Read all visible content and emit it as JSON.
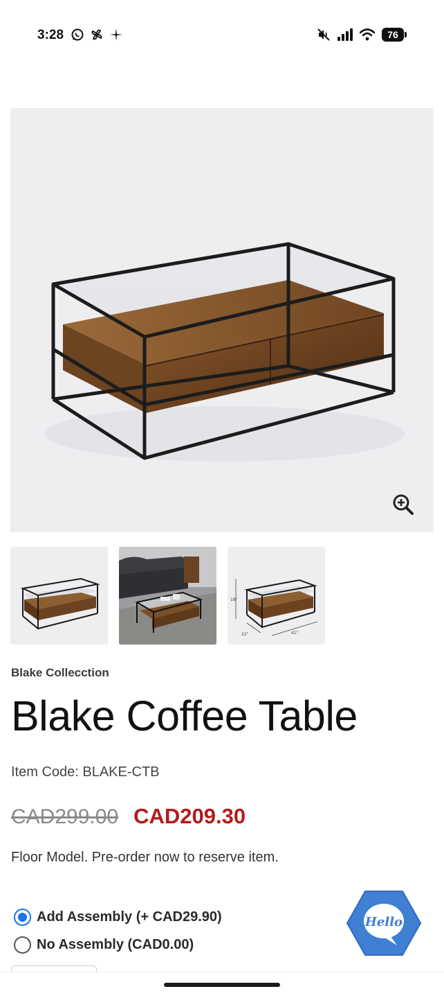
{
  "status_bar": {
    "time": "3:28",
    "battery": "76",
    "icons": [
      "whatsapp-icon",
      "pinwheel-icon",
      "sparkle-icon",
      "mute-icon",
      "signal-icon",
      "wifi-icon",
      "battery-icon"
    ]
  },
  "gallery": {
    "main_image": "glass-top coffee table with rustic wood drawers",
    "zoom_icon": "zoom-in-icon",
    "thumbnails": [
      "table-front-view",
      "table-room-view",
      "table-dimensions-view"
    ]
  },
  "thumb_dims": {
    "height": "18\"",
    "depth": "22\"",
    "width": "41\""
  },
  "product": {
    "collection": "Blake Collecction",
    "title": "Blake Coffee Table",
    "item_code": "Item Code: BLAKE-CTB",
    "price_old": "CAD299.00",
    "price_new": "CAD209.30",
    "note": "Floor Model. Pre-order now to reserve item."
  },
  "options": {
    "add_assembly": "Add Assembly (+ CAD29.90)",
    "no_assembly": "No Assembly (CAD0.00)",
    "selected": "add_assembly"
  },
  "chat": {
    "label": "Hello"
  },
  "colors": {
    "sale_red": "#b31b1b",
    "chat_blue": "#3f7fd4",
    "radio_blue": "#1a73e8"
  }
}
